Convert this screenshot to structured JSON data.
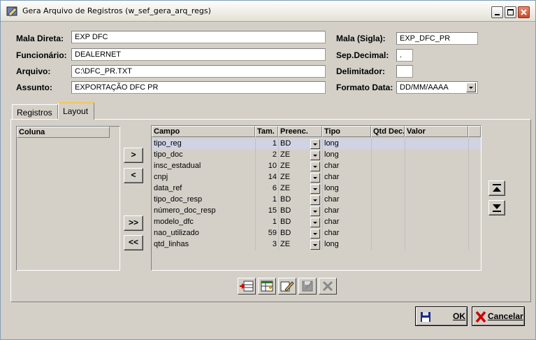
{
  "window": {
    "title": "Gera Arquivo de Registros (w_sef_gera_arq_regs)"
  },
  "form": {
    "mala_direta_label": "Mala Direta:",
    "mala_direta_value": "EXP DFC",
    "funcionario_label": "Funcionário:",
    "funcionario_value": "DEALERNET",
    "arquivo_label": "Arquivo:",
    "arquivo_value": "C:\\DFC_PR.TXT",
    "assunto_label": "Assunto:",
    "assunto_value": "EXPORTAÇÃO DFC PR",
    "mala_sigla_label": "Mala (Sigla):",
    "mala_sigla_value": "EXP_DFC_PR",
    "sep_decimal_label": "Sep.Decimal:",
    "sep_decimal_value": ".",
    "delimitador_label": "Delimitador:",
    "delimitador_value": "",
    "formato_data_label": "Formato Data:",
    "formato_data_value": "DD/MM/AAAA"
  },
  "tabs": [
    {
      "label": "Registros",
      "active": false
    },
    {
      "label": "Layout",
      "active": true
    }
  ],
  "left_list": {
    "header": "Coluna"
  },
  "move_buttons": {
    "add_one": ">",
    "remove_one": "<",
    "add_all": ">>",
    "remove_all": "<<"
  },
  "grid": {
    "columns": [
      "Campo",
      "Tam.",
      "Preenc.",
      "Tipo",
      "Qtd Dec.",
      "Valor"
    ],
    "rows": [
      {
        "campo": "tipo_reg",
        "tam": "1",
        "preenc": "BD",
        "tipo": "long"
      },
      {
        "campo": "tipo_doc",
        "tam": "2",
        "preenc": "ZE",
        "tipo": "long"
      },
      {
        "campo": "insc_estadual",
        "tam": "10",
        "preenc": "ZE",
        "tipo": "char"
      },
      {
        "campo": "cnpj",
        "tam": "14",
        "preenc": "ZE",
        "tipo": "char"
      },
      {
        "campo": "data_ref",
        "tam": "6",
        "preenc": "ZE",
        "tipo": "long"
      },
      {
        "campo": "tipo_doc_resp",
        "tam": "1",
        "preenc": "BD",
        "tipo": "char"
      },
      {
        "campo": "número_doc_resp",
        "tam": "15",
        "preenc": "BD",
        "tipo": "char"
      },
      {
        "campo": "modelo_dfc",
        "tam": "1",
        "preenc": "BD",
        "tipo": "char"
      },
      {
        "campo": "nao_utilizado",
        "tam": "59",
        "preenc": "BD",
        "tipo": "char"
      },
      {
        "campo": "qtd_linhas",
        "tam": "3",
        "preenc": "ZE",
        "tipo": "long"
      }
    ]
  },
  "buttons": {
    "ok_label": "OK",
    "cancel_label": "Cancelar"
  },
  "colors": {
    "selected_row": "#cfd3e3",
    "face": "#d4d0c8",
    "accent_tab": "#f5c652"
  }
}
